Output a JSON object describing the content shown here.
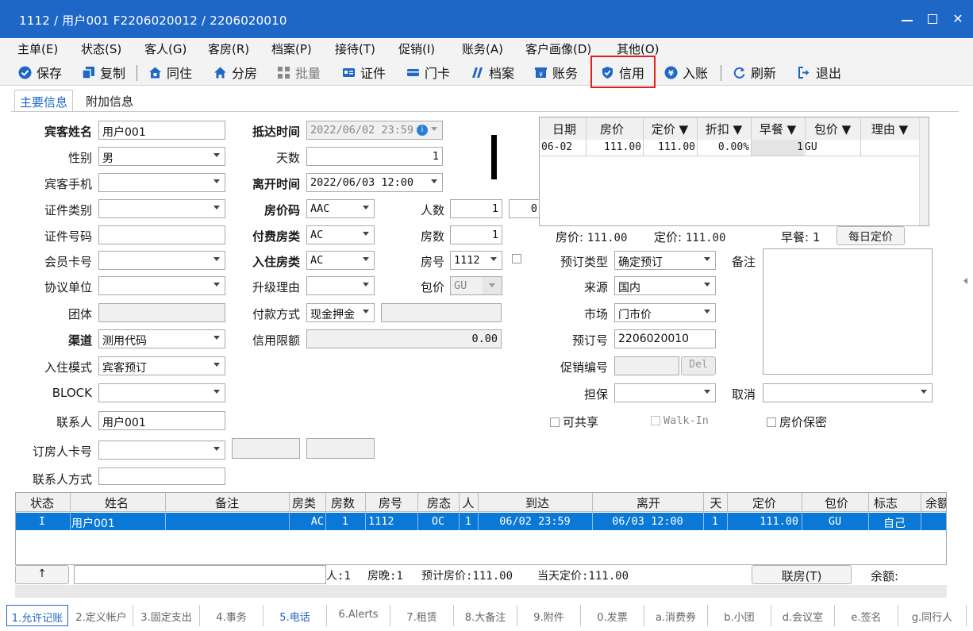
{
  "window": {
    "title": "1112 / 用户001 F2206020012 / 2206020010"
  },
  "menu": [
    "主单(E)",
    "状态(S)",
    "客人(G)",
    "客房(R)",
    "档案(P)",
    "接待(T)",
    "促销(I)",
    "账务(A)",
    "客户画像(D)",
    "其他(O)"
  ],
  "toolbar": {
    "save": "保存",
    "copy": "复制",
    "cohabit": "同住",
    "split": "分房",
    "batch": "批量",
    "id_card": "证件",
    "door_card": "门卡",
    "profile": "档案",
    "account": "账务",
    "credit": "信用",
    "post": "入账",
    "refresh": "刷新",
    "exit": "退出"
  },
  "tabs": {
    "main": "主要信息",
    "extra": "附加信息"
  },
  "form": {
    "guest_name_label": "宾客姓名",
    "guest_name": "用户001",
    "gender_label": "性别",
    "gender": "男",
    "mobile_label": "宾客手机",
    "mobile": "",
    "id_type_label": "证件类别",
    "id_type": "",
    "id_no_label": "证件号码",
    "id_no": "",
    "member_label": "会员卡号",
    "member": "",
    "agreement_label": "协议单位",
    "agreement": "",
    "group_label": "团体",
    "group": "",
    "channel_label": "渠道",
    "channel": "测用代码",
    "checkin_mode_label": "入住模式",
    "checkin_mode": "宾客预订",
    "block_label": "BLOCK",
    "block": "",
    "contact_label": "联系人",
    "contact": "用户001",
    "booker_card_label": "订房人卡号",
    "booker_card": "",
    "contact_method_label": "联系人方式",
    "contact_method": "",
    "arrival_label": "抵达时间",
    "arrival": "2022/06/02 23:59",
    "days_label": "天数",
    "days": "1",
    "departure_label": "离开时间",
    "departure": "2022/06/03 12:00",
    "rate_code_label": "房价码",
    "rate_code": "AAC",
    "persons_label": "人数",
    "persons": "1",
    "persons_extra": "0",
    "pay_room_type_label": "付费房类",
    "pay_room_type": "AC",
    "room_count_label": "房数",
    "room_count": "1",
    "stay_room_type_label": "入住房类",
    "stay_room_type": "AC",
    "room_no_label": "房号",
    "room_no": "1112",
    "upgrade_label": "升级理由",
    "upgrade": "",
    "package_label": "包价",
    "package": "GU",
    "pay_method_label": "付款方式",
    "pay_method": "现金押金",
    "credit_limit_label": "信用限额",
    "credit_limit": "0.00",
    "booking_type_label": "预订类型",
    "booking_type": "确定预订",
    "source_label": "来源",
    "source": "国内",
    "market_label": "市场",
    "market": "门市价",
    "booking_no_label": "预订号",
    "booking_no": "2206020010",
    "promo_label": "促销编号",
    "promo": "",
    "promo_del": "Del",
    "guarantee_label": "担保",
    "guarantee": "",
    "cancel_label": "取消",
    "cancel": "",
    "remarks_label": "备注",
    "shareable": "可共享",
    "walkin": "Walk-In",
    "rate_secret": "房价保密"
  },
  "price_grid": {
    "headers": [
      "日期",
      "房价",
      "定价 ▼",
      "折扣 ▼",
      "早餐 ▼",
      "包价 ▼",
      "理由 ▼"
    ],
    "row": {
      "date": "06-02",
      "rate": "111.00",
      "fixed": "111.00",
      "discount": "0.00%",
      "breakfast": "1",
      "package": "GU",
      "reason": ""
    },
    "summary_rate_label": "房价:",
    "summary_rate": "111.00",
    "summary_fixed_label": "定价:",
    "summary_fixed": "111.00",
    "summary_breakfast": "早餐: 1",
    "daily_fix_button": "每日定价"
  },
  "guest_table": {
    "headers": [
      "状态",
      "姓名",
      "备注",
      "房类",
      "房数",
      "房号",
      "房态",
      "人",
      "到达",
      "离开",
      "天",
      "定价",
      "包价",
      "标志",
      "余额"
    ],
    "row": {
      "status": "I",
      "name": "用户001",
      "remark": "",
      "room_type": "AC",
      "rooms": "1",
      "room_no": "1112",
      "room_status": "OC",
      "persons": "1",
      "arrive": "06/02 23:59",
      "depart": "06/03 12:00",
      "days": "1",
      "rate": "111.00",
      "package": "GU",
      "flag": "自己",
      "balance": ""
    }
  },
  "status_bar": {
    "up_button": "↑",
    "persons": "人:1",
    "room_nights": "房晚:1",
    "est_rate": "预计房价:111.00",
    "today_rate": "当天定价:111.00",
    "link_button": "联房(T)",
    "balance_label": "余额:"
  },
  "bottom_tabs": [
    "1.允许记账",
    "2.定义帐户",
    "3.固定支出",
    "4.事务",
    "5.电话",
    "6.Alerts",
    "7.租赁",
    "8.大备注",
    "9.附件",
    "0.发票",
    "a.消费券",
    "b.小团",
    "d.会议室",
    "e.签名",
    "g.同行人"
  ],
  "colors": {
    "title_bar": "#1e67c6",
    "selection": "#0a78d6",
    "highlight": "#e02020"
  }
}
